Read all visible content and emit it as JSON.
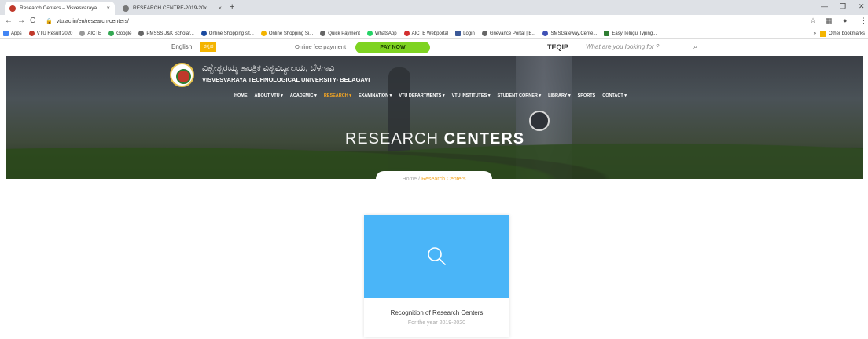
{
  "browser": {
    "tabs": [
      {
        "title": "Research Centers – Visvesvaraya",
        "close": "×"
      },
      {
        "title": "RESEARCH CENTRE-2019-20x",
        "close": "×"
      }
    ],
    "new_tab": "+",
    "url": "vtu.ac.in/en/research-centers/",
    "bookmarks": [
      "Apps",
      "VTU Result 2020",
      "AICTE",
      "Google",
      "PMSSS J&K Scholar...",
      "Online Shopping sit...",
      "Online Shopping Si...",
      "Quick Payment",
      "WhatsApp",
      "AICTE Webportal",
      "Login",
      "Grievance Portal | B...",
      "SMSGateway.Cente...",
      "Easy Telugu Typing..."
    ],
    "other_bookmarks": "Other bookmarks"
  },
  "topbar": {
    "lang_en": "English",
    "lang_kn": "ಕನ್ನಡ",
    "fee_text": "Online fee payment",
    "pay_now": "PAY NOW",
    "teqip": "TEQIP",
    "search_placeholder": "What are you looking for ?"
  },
  "hero": {
    "kannada_title": "ವಿಶ್ವೇಶ್ವರಯ್ಯ ತಾಂತ್ರಿಕ ವಿಶ್ವವಿದ್ಯಾಲಯ, ಬೆಳಗಾವಿ",
    "english_title": "VISVESVARAYA TECHNOLOGICAL UNIVERSITY- BELAGAVI",
    "nav": [
      {
        "label": "HOME"
      },
      {
        "label": "ABOUT VTU ▾"
      },
      {
        "label": "ACADEMIC ▾"
      },
      {
        "label": "RESEARCH ▾"
      },
      {
        "label": "EXAMINATION ▾"
      },
      {
        "label": "VTU DEPARTMENTS ▾"
      },
      {
        "label": "VTU INSTITUTES ▾"
      },
      {
        "label": "STUDENT CORNER ▾"
      },
      {
        "label": "LIBRARY ▾"
      },
      {
        "label": "SPORTS"
      },
      {
        "label": "CONTACT ▾"
      }
    ],
    "active_nav": "RESEARCH",
    "title_thin": "RESEARCH",
    "title_bold": "CENTERS"
  },
  "breadcrumb": {
    "home": "Home",
    "sep": "/",
    "current": "Research Centers"
  },
  "card": {
    "title": "Recognition of Research Centers",
    "subtitle": "For the year 2019-2020",
    "accent": "#4ab5f8",
    "icon": "search-icon"
  }
}
